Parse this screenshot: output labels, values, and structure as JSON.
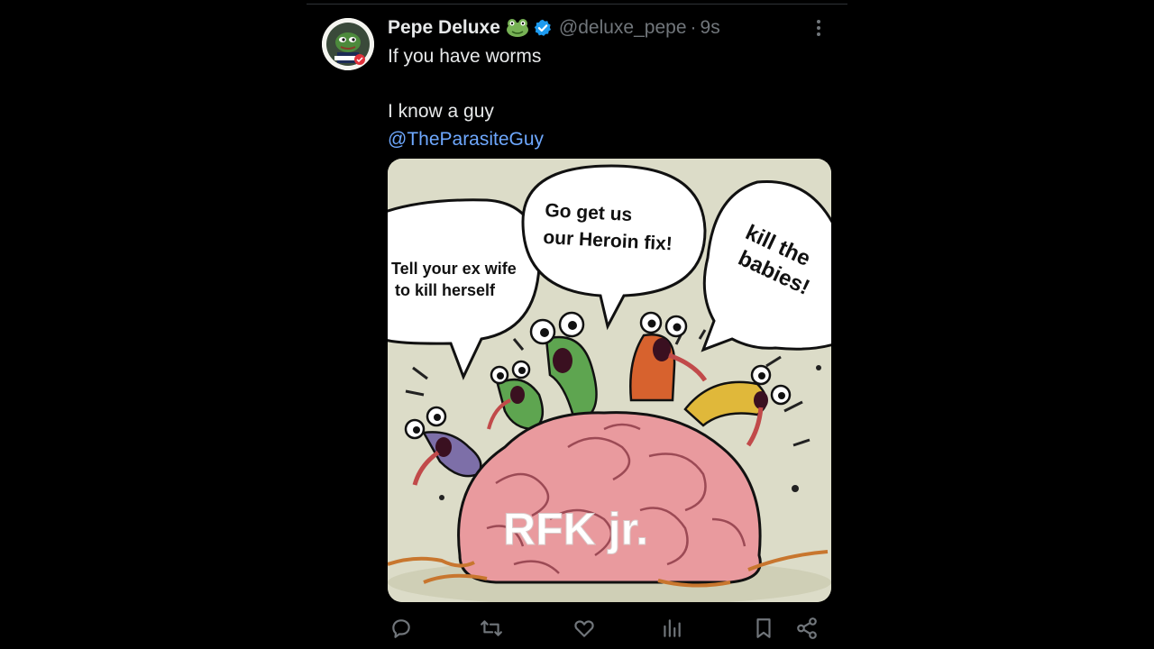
{
  "tweet": {
    "author_name": "Pepe Deluxe",
    "author_emoji": "frog-emoji",
    "verified": true,
    "handle": "@deluxe_pepe",
    "separator": "·",
    "timestamp": "9s",
    "text_lines": [
      "If you have worms",
      "",
      "I know a guy"
    ],
    "mention": "@TheParasiteGuy"
  },
  "media": {
    "bubble_left": [
      "Tell your ex wife",
      "to kill herself"
    ],
    "bubble_center": [
      "Go get us",
      "our Heroin fix!"
    ],
    "bubble_right": [
      "kill the",
      "babies!"
    ],
    "caption": "RFK jr."
  },
  "actions": {
    "icons": [
      "reply-icon",
      "retweet-icon",
      "like-icon",
      "views-icon",
      "bookmark-icon",
      "share-icon"
    ]
  },
  "colors": {
    "background": "#000000",
    "text": "#e7e9ea",
    "muted": "#71767b",
    "link": "#6ea8fe",
    "verified": "#1d9bf0"
  }
}
